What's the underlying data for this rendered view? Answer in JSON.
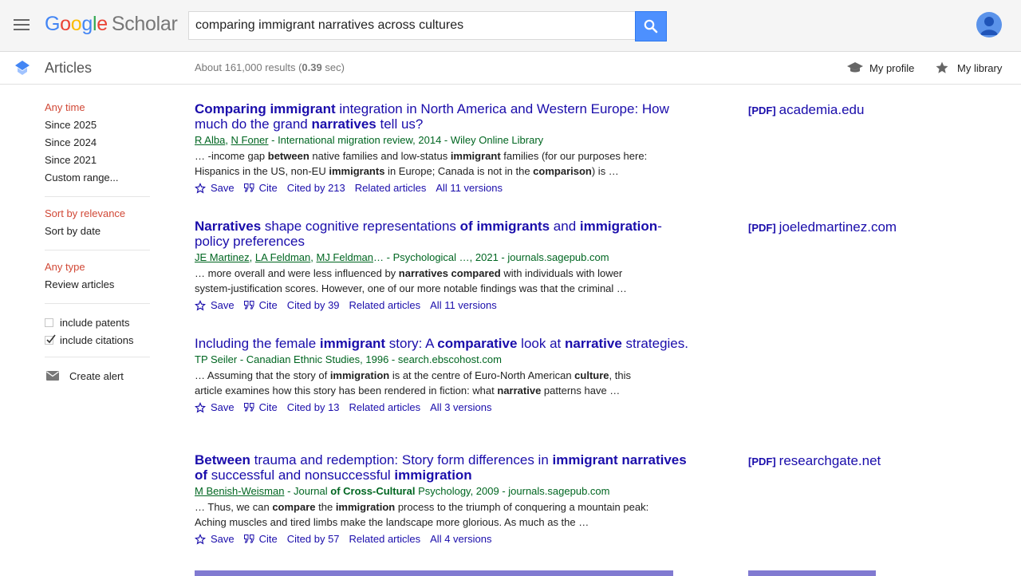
{
  "header": {
    "logo_google": "Google",
    "logo_scholar": "Scholar",
    "search_value": "comparing immigrant narratives across cultures"
  },
  "subheader": {
    "section": "Articles",
    "results_prefix": "About 161,000 results (",
    "results_time": "0.39",
    "results_suffix": " sec)",
    "my_profile": "My profile",
    "my_library": "My library"
  },
  "sidebar": {
    "time_filters": [
      "Any time",
      "Since 2025",
      "Since 2024",
      "Since 2021",
      "Custom range..."
    ],
    "sort_filters": [
      "Sort by relevance",
      "Sort by date"
    ],
    "type_filters": [
      "Any type",
      "Review articles"
    ],
    "include_patents": "include patents",
    "include_citations": "include citations",
    "create_alert": "Create alert"
  },
  "results": [
    {
      "title_parts": [
        {
          "b": true,
          "t": "Comparing immigrant"
        },
        {
          "b": false,
          "t": " integration in North America and Western Europe: How much do the grand "
        },
        {
          "b": true,
          "t": "narratives"
        },
        {
          "b": false,
          "t": " tell us?"
        }
      ],
      "authors": [
        "R Alba",
        "N Foner"
      ],
      "source": " - International migration review, 2014 - Wiley Online Library",
      "snippet_parts": [
        {
          "b": false,
          "t": "… -income gap "
        },
        {
          "b": true,
          "t": "between"
        },
        {
          "b": false,
          "t": " native families and low-status "
        },
        {
          "b": true,
          "t": "immigrant"
        },
        {
          "b": false,
          "t": " families (for our purposes here: Hispanics in the US, non-EU "
        },
        {
          "b": true,
          "t": "immigrants"
        },
        {
          "b": false,
          "t": " in Europe; Canada is not in the "
        },
        {
          "b": true,
          "t": "comparison"
        },
        {
          "b": false,
          "t": ") is …"
        }
      ],
      "save": "Save",
      "cite": "Cite",
      "cited_by": "Cited by 213",
      "related": "Related articles",
      "versions": "All 11 versions",
      "pdf_tag": "[PDF]",
      "pdf_source": "academia.edu"
    },
    {
      "title_parts": [
        {
          "b": true,
          "t": "Narratives"
        },
        {
          "b": false,
          "t": " shape cognitive representations "
        },
        {
          "b": true,
          "t": "of immigrants"
        },
        {
          "b": false,
          "t": " and "
        },
        {
          "b": true,
          "t": "immigration"
        },
        {
          "b": false,
          "t": "-policy preferences"
        }
      ],
      "authors": [
        "JE Martinez",
        "LA Feldman",
        "MJ Feldman"
      ],
      "source": "… - Psychological …, 2021 - journals.sagepub.com",
      "snippet_parts": [
        {
          "b": false,
          "t": "… more overall and were less influenced by "
        },
        {
          "b": true,
          "t": "narratives compared"
        },
        {
          "b": false,
          "t": " with individuals with lower system-justification scores. However, one of our more notable findings was that the criminal …"
        }
      ],
      "save": "Save",
      "cite": "Cite",
      "cited_by": "Cited by 39",
      "related": "Related articles",
      "versions": "All 11 versions",
      "pdf_tag": "[PDF]",
      "pdf_source": "joeledmartinez.com"
    },
    {
      "title_parts": [
        {
          "b": false,
          "t": "Including the female "
        },
        {
          "b": true,
          "t": "immigrant"
        },
        {
          "b": false,
          "t": " story: A "
        },
        {
          "b": true,
          "t": "comparative"
        },
        {
          "b": false,
          "t": " look at "
        },
        {
          "b": true,
          "t": "narrative"
        },
        {
          "b": false,
          "t": " strategies."
        }
      ],
      "authors": [],
      "source": "TP Seiler - Canadian Ethnic Studies, 1996 - search.ebscohost.com",
      "snippet_parts": [
        {
          "b": false,
          "t": "… Assuming that the story of "
        },
        {
          "b": true,
          "t": "immigration"
        },
        {
          "b": false,
          "t": " is at the centre of Euro-North American "
        },
        {
          "b": true,
          "t": "culture"
        },
        {
          "b": false,
          "t": ", this article examines how this story has been rendered in fiction: what "
        },
        {
          "b": true,
          "t": "narrative"
        },
        {
          "b": false,
          "t": " patterns have …"
        }
      ],
      "save": "Save",
      "cite": "Cite",
      "cited_by": "Cited by 13",
      "related": "Related articles",
      "versions": "All 3 versions",
      "pdf_tag": "",
      "pdf_source": ""
    },
    {
      "title_parts": [
        {
          "b": true,
          "t": "Between"
        },
        {
          "b": false,
          "t": " trauma and redemption: Story form differences in "
        },
        {
          "b": true,
          "t": "immigrant narratives of"
        },
        {
          "b": false,
          "t": " successful and nonsuccessful "
        },
        {
          "b": true,
          "t": "immigration"
        }
      ],
      "authors": [
        "M Benish-Weisman"
      ],
      "source_parts": [
        {
          "b": false,
          "t": " - Journal "
        },
        {
          "b": true,
          "t": "of Cross-Cultural"
        },
        {
          "b": false,
          "t": " Psychology, 2009 - journals.sagepub.com"
        }
      ],
      "snippet_parts": [
        {
          "b": false,
          "t": "… Thus, we can "
        },
        {
          "b": true,
          "t": "compare"
        },
        {
          "b": false,
          "t": " the "
        },
        {
          "b": true,
          "t": "immigration"
        },
        {
          "b": false,
          "t": " process to the triumph of conquering a mountain peak: Aching muscles and tired limbs make the landscape more glorious. As much as the …"
        }
      ],
      "save": "Save",
      "cite": "Cite",
      "cited_by": "Cited by 57",
      "related": "Related articles",
      "versions": "All 4 versions",
      "pdf_tag": "[PDF]",
      "pdf_source": "researchgate.net"
    }
  ]
}
